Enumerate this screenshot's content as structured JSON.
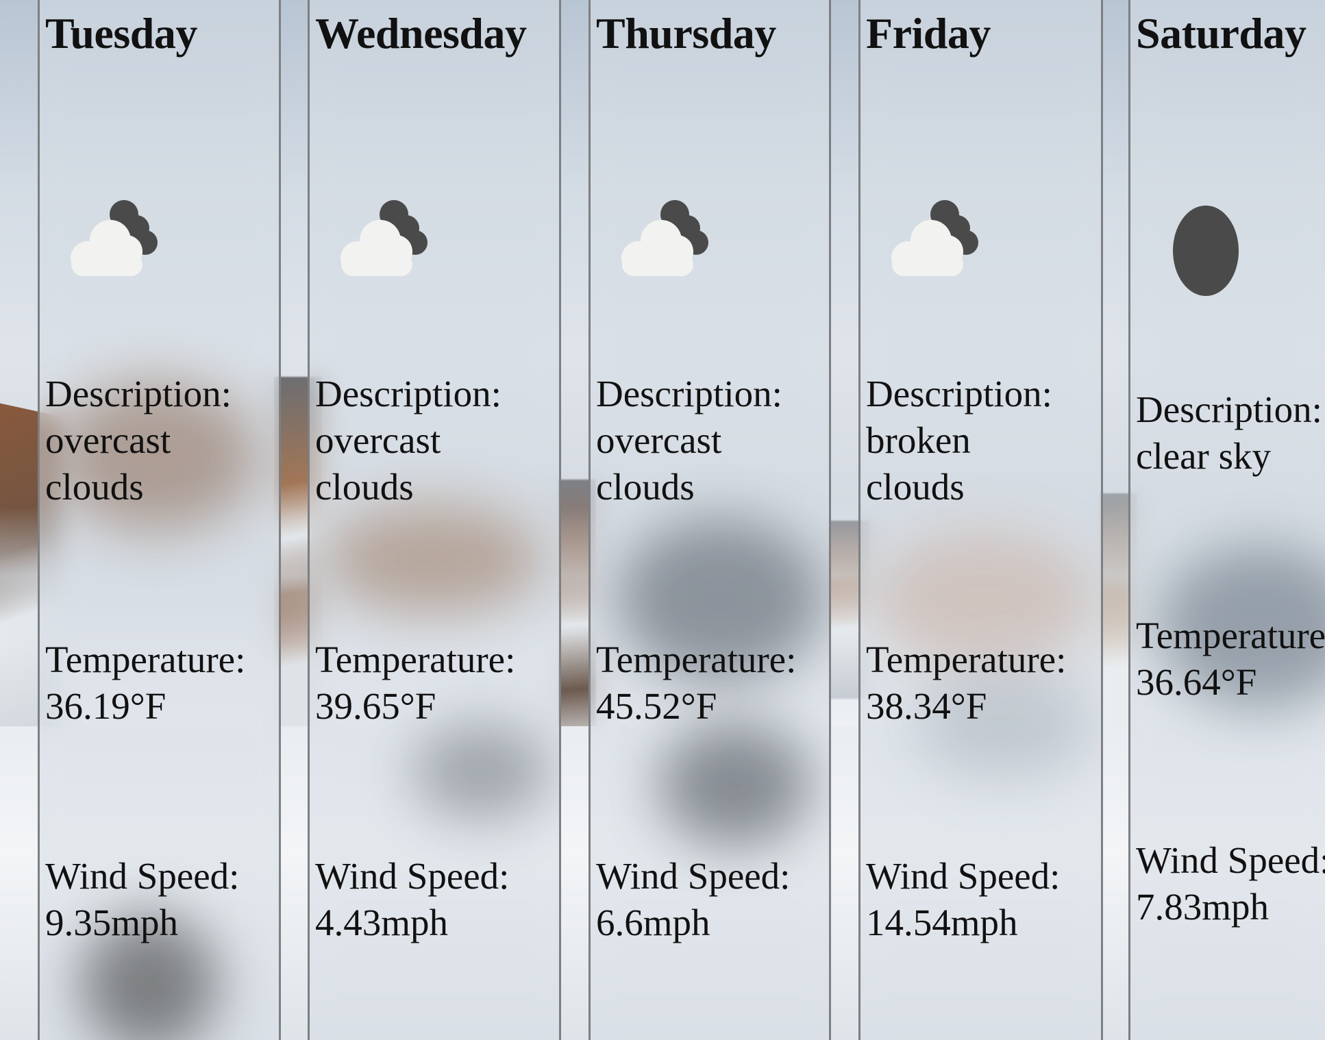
{
  "forecast": [
    {
      "day": "Tuesday",
      "icon": "broken-clouds-icon",
      "description_label": "Description:",
      "description_lines": [
        "overcast",
        "clouds"
      ],
      "temperature_label": "Temperature:",
      "temperature": "36.19°F",
      "wind_label": "Wind Speed:",
      "wind_speed": "9.35mph"
    },
    {
      "day": "Wednesday",
      "icon": "broken-clouds-icon",
      "description_label": "Description:",
      "description_lines": [
        "overcast",
        "clouds"
      ],
      "temperature_label": "Temperature:",
      "temperature": "39.65°F",
      "wind_label": "Wind Speed:",
      "wind_speed": "4.43mph"
    },
    {
      "day": "Thursday",
      "icon": "broken-clouds-icon",
      "description_label": "Description:",
      "description_lines": [
        "overcast",
        "clouds"
      ],
      "temperature_label": "Temperature:",
      "temperature": "45.52°F",
      "wind_label": "Wind Speed:",
      "wind_speed": "6.6mph"
    },
    {
      "day": "Friday",
      "icon": "broken-clouds-icon",
      "description_label": "Description:",
      "description_lines": [
        "broken",
        "clouds"
      ],
      "temperature_label": "Temperature:",
      "temperature": "38.34°F",
      "wind_label": "Wind Speed:",
      "wind_speed": "14.54mph"
    },
    {
      "day": "Saturday",
      "icon": "clear-sky-icon",
      "description_label": "Description:",
      "description_lines": [
        "clear sky"
      ],
      "temperature_label": "Temperature:",
      "temperature": "36.64°F",
      "wind_label": "Wind Speed:",
      "wind_speed": "7.83mph"
    }
  ],
  "colors": {
    "card_border": "#7d7f82",
    "icon_light_cloud": "#f2f2f0",
    "icon_dark": "#4a4a4a",
    "text": "#111111"
  }
}
